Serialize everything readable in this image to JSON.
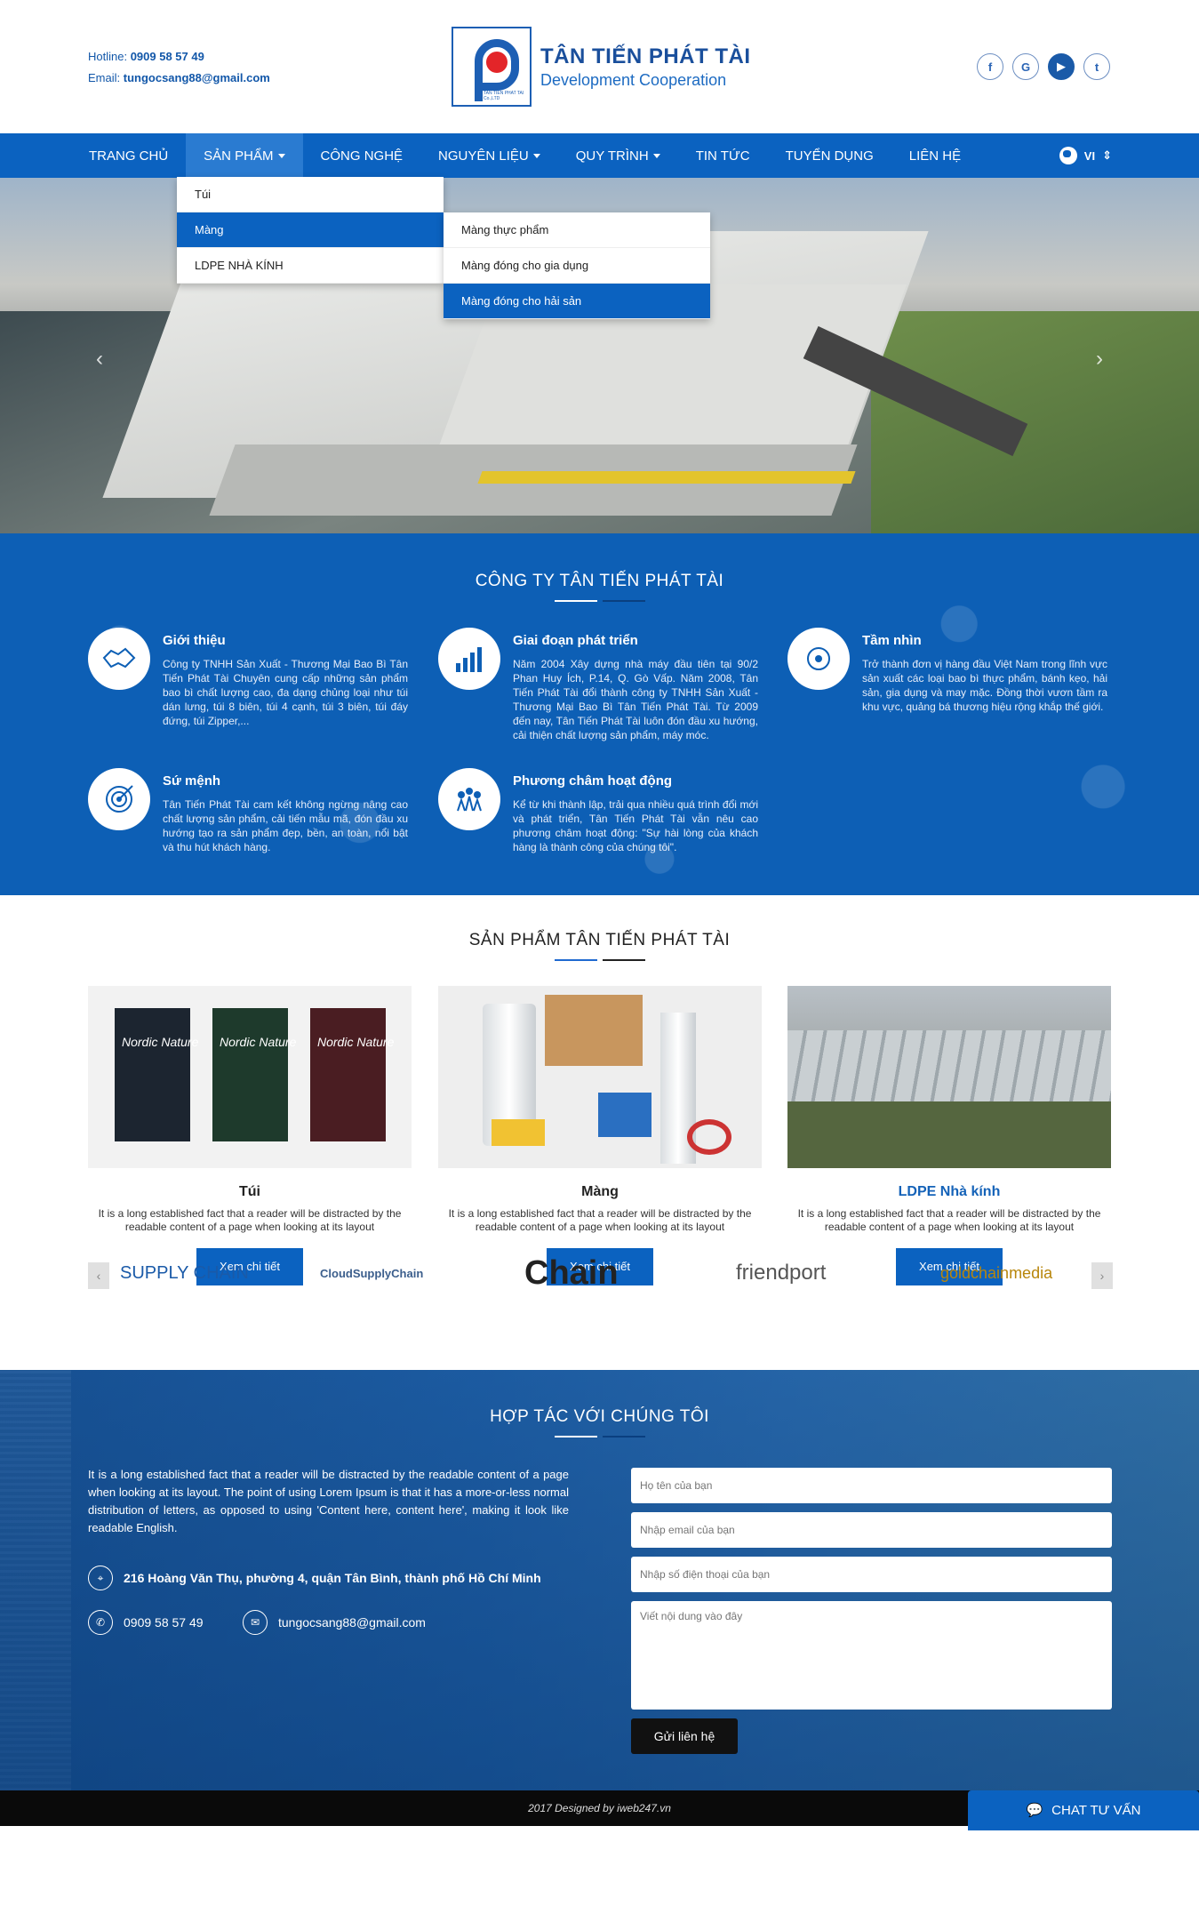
{
  "header": {
    "hotline_label": "Hotline:",
    "hotline": "0909 58 57 49",
    "email_label": "Email:",
    "email": "tungocsang88@gmail.com",
    "logo_title": "TÂN TIẾN PHÁT TÀI",
    "logo_subtitle": "Development Cooperation",
    "logo_small": "TAN TIEN PHAT TAI Co.,LTD",
    "socials": [
      "f",
      "G",
      "▶",
      "t"
    ]
  },
  "nav": {
    "items": [
      {
        "label": "TRANG CHỦ"
      },
      {
        "label": "SẢN PHẨM"
      },
      {
        "label": "CÔNG NGHỆ"
      },
      {
        "label": "NGUYÊN LIỆU"
      },
      {
        "label": "QUY TRÌNH"
      },
      {
        "label": "TIN TỨC"
      },
      {
        "label": "TUYỂN DỤNG"
      },
      {
        "label": "LIÊN HỆ"
      }
    ],
    "lang": "VI",
    "dropdown": [
      "Túi",
      "Màng",
      "LDPE NHÀ KÍNH"
    ],
    "subdropdown": [
      "Màng thực phẩm",
      "Màng đóng cho gia dụng",
      "Màng đóng cho hải sản"
    ]
  },
  "about": {
    "title": "CÔNG TY TÂN TIẾN PHÁT TÀI",
    "items": [
      {
        "title": "Giới thiệu",
        "text": "Công ty TNHH Sản Xuất - Thương Mại Bao Bì Tân Tiến Phát Tài Chuyên cung cấp những sản phẩm bao bì chất lượng cao, đa dạng chủng loại như túi dán lưng, túi 8 biên, túi 4 cạnh, túi 3 biên, túi đáy đứng, túi Zipper,..."
      },
      {
        "title": "Giai đoạn phát triển",
        "text": "Năm 2004 Xây dựng nhà máy đầu tiên tại 90/2 Phan Huy Ích, P.14, Q. Gò Vấp. Năm 2008, Tân Tiến Phát Tài đổi thành công ty TNHH Sản Xuất - Thương Mại Bao Bì Tân Tiến Phát Tài. Từ 2009 đến nay, Tân Tiến Phát Tài luôn đón đầu xu hướng, cải thiện chất lượng sản phẩm, máy móc."
      },
      {
        "title": "Tầm nhìn",
        "text": "Trở thành đơn vị hàng đầu Việt Nam trong lĩnh vực sản xuất các loại bao bì thực phẩm, bánh kẹo, hải sản, gia dụng và may mặc. Đồng thời vươn tầm ra khu vực, quảng bá thương hiệu rộng khắp thế giới."
      },
      {
        "title": "Sứ mệnh",
        "text": "Tân Tiến Phát Tài cam kết không ngừng nâng cao chất lượng sản phẩm, cải tiến mẫu mã, đón đầu xu hướng tạo ra sản phẩm đẹp, bền, an toàn, nổi bật và thu hút khách hàng."
      },
      {
        "title": "Phương châm hoạt động",
        "text": "Kể từ khi thành lập, trải qua nhiều quá trình đổi mới và phát triển, Tân Tiến Phát Tài vẫn nêu cao phương châm hoạt động: \"Sự hài lòng của khách hàng là thành công của chúng tôi\"."
      }
    ]
  },
  "products": {
    "title": "SẢN PHẨM TÂN TIẾN PHÁT TÀI",
    "items": [
      {
        "name": "Túi",
        "desc": "It is a long established fact that a reader will be distracted by the readable content of a page when looking at its layout",
        "btn": "Xem chi tiết",
        "pkg_text": "Nordic Nature"
      },
      {
        "name": "Màng",
        "desc": "It is a long established fact that a reader will be distracted by the readable content of a page when looking at its layout",
        "btn": "Xem chi tiết"
      },
      {
        "name": "LDPE Nhà kính",
        "desc": "It is a long established fact that a reader will be distracted by the readable content of a page when looking at its layout",
        "btn": "Xem chi tiết"
      }
    ]
  },
  "partners": [
    "SUPPLY CHAIN",
    "CloudSupplyChain",
    "Chain",
    "friendport",
    "goldchainmedia"
  ],
  "contact": {
    "title": "HỢP TÁC VỚI CHÚNG TÔI",
    "desc": "It is a long established fact that a reader will be distracted by the readable content of a page when looking at its layout. The point of using Lorem Ipsum is that it has a more-or-less normal distribution of letters, as opposed to using 'Content here, content here', making it look like readable English.",
    "address": "216 Hoàng Văn Thụ, phường 4, quận Tân Bình, thành phố Hồ Chí Minh",
    "phone": "0909 58 57 49",
    "email": "tungocsang88@gmail.com",
    "ph_name": "Họ tên của bạn",
    "ph_email": "Nhập email của bạn",
    "ph_phone": "Nhập số điện thoại của bạn",
    "ph_message": "Viết nội dung vào đây",
    "send": "Gửi liên hệ"
  },
  "footer": {
    "credit": "2017 Designed by iweb247.vn",
    "chat": "CHAT TƯ VẤN"
  },
  "colors": {
    "primary": "#0b62c0",
    "dark_blue": "#1a4f9c",
    "accent_red": "#e32529"
  }
}
